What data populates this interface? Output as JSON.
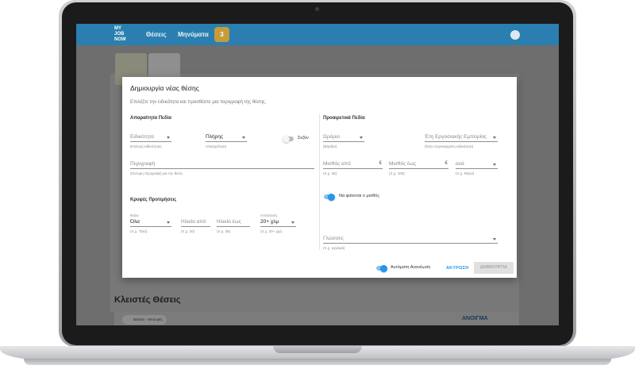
{
  "app": {
    "logo": [
      "MY",
      "JOB",
      "NOW"
    ],
    "nav": [
      "Θέσεις",
      "Μηνύματα"
    ],
    "badge_count": "3",
    "closed_section_title": "Κλειστές Θέσεις",
    "closed_item_chip": "Barista - Μπουφές",
    "closed_item_action": "ΑΝΟΙΓΜΑ"
  },
  "modal": {
    "title": "Δημιουργία νέας θέσης",
    "subtitle": "Επιλέξτε την ειδικότητα και προσθέστε μια περιγραφή της θέσης.",
    "required_title": "Απαραίτητα Πεδία",
    "optional_title": "Προαιρετικά Πεδία",
    "hidden_prefs_title": "Κρυφές Προτιμήσεις",
    "specialty": {
      "placeholder": "Ειδικότητα",
      "helper": "Επιλογή ειδικότητας"
    },
    "employment": {
      "value": "Πλήρης",
      "helper": "Απασχόληση"
    },
    "season_toggle": {
      "label": "Σεζόν",
      "on": false
    },
    "description": {
      "placeholder": "Περιγραφή",
      "helper": "Σύντομη περιγραφή για την θέση."
    },
    "gender": {
      "label": "Φύλο",
      "value": "Όλα",
      "helper": "(π.χ. 'Όλα)"
    },
    "age_from": {
      "placeholder": "Ηλικία από",
      "helper": "(π.χ. 20)"
    },
    "age_to": {
      "placeholder": "Ηλικία έως",
      "helper": "(π.χ. 35)"
    },
    "distance": {
      "label": "Απόσταση",
      "value": "20+ χλμ",
      "helper": "(π.χ. 20+ χιμ)"
    },
    "schedule": {
      "placeholder": "Ωράριο",
      "helper": "(Βάρδια)"
    },
    "experience": {
      "placeholder": "Έτη Εργασιακής Εμπειρίας",
      "helper": "(Στην συγκεκριμένη ειδικότητα)"
    },
    "salary_from": {
      "placeholder": "Μισθός από",
      "currency": "€",
      "helper": "(π.χ. 3€)"
    },
    "salary_to": {
      "placeholder": "Μισθός έως",
      "currency": "€",
      "helper": "(π.χ. 10€)"
    },
    "per": {
      "placeholder": "ανά",
      "helper": "(π.χ. Μήνα)"
    },
    "show_salary_toggle": {
      "label": "Να φαίνεται ο μισθός",
      "on": true
    },
    "languages": {
      "placeholder": "Γλώσσες",
      "helper": "(π.χ. αγγλικά)"
    },
    "auto_renew_toggle": {
      "label": "Αυτόματη Ανανέωση",
      "on": true
    },
    "cancel_label": "ΑΚΥΡΩΣΗ",
    "create_label": "ΔΗΜΙΟΥΡΓΙΑ"
  },
  "colors": {
    "accent": "#2196f3",
    "header": "#2a7fb0"
  }
}
